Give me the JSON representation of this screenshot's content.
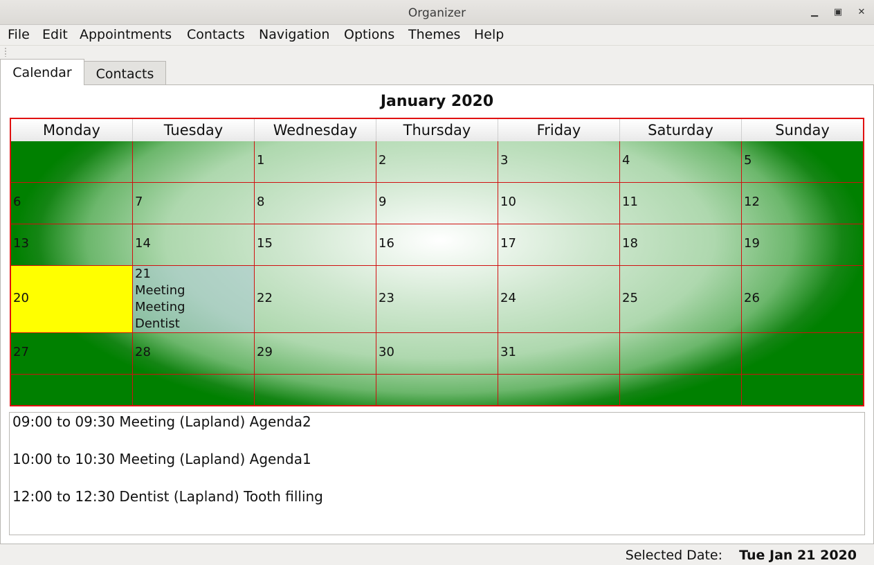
{
  "window": {
    "title": "Organizer",
    "minimize_icon": "minimize-icon",
    "maximize_icon": "maximize-icon",
    "close_icon": "close-icon"
  },
  "menu": [
    "File",
    "Edit",
    "Appointments",
    "Contacts",
    "Navigation",
    "Options",
    "Themes",
    "Help"
  ],
  "tabs": [
    {
      "label": "Calendar",
      "active": true
    },
    {
      "label": "Contacts",
      "active": false
    }
  ],
  "calendar": {
    "month_title": "January 2020",
    "days": [
      "Monday",
      "Tuesday",
      "Wednesday",
      "Thursday",
      "Friday",
      "Saturday",
      "Sunday"
    ],
    "weeks": [
      [
        "",
        "",
        "1",
        "2",
        "3",
        "4",
        "5"
      ],
      [
        "6",
        "7",
        "8",
        "9",
        "10",
        "11",
        "12"
      ],
      [
        "13",
        "14",
        "15",
        "16",
        "17",
        "18",
        "19"
      ],
      [
        "20",
        "21",
        "22",
        "23",
        "24",
        "25",
        "26"
      ],
      [
        "27",
        "28",
        "29",
        "30",
        "31",
        "",
        ""
      ],
      [
        "",
        "",
        "",
        "",
        "",
        "",
        ""
      ]
    ],
    "today": "20",
    "selected": "21",
    "day_appointments": {
      "21": [
        "Meeting",
        "Meeting",
        "Dentist"
      ]
    },
    "colors": {
      "grid_border": "#e01010",
      "today_bg": "#ffff00",
      "gradient_outer": "#008000",
      "gradient_center": "#ffffff"
    }
  },
  "appointments": [
    "09:00 to 09:30 Meeting (Lapland) Agenda2",
    "10:00 to 10:30 Meeting (Lapland) Agenda1",
    "12:00 to 12:30 Dentist (Lapland) Tooth filling"
  ],
  "status": {
    "label": "Selected Date:",
    "value": "Tue Jan 21 2020"
  }
}
